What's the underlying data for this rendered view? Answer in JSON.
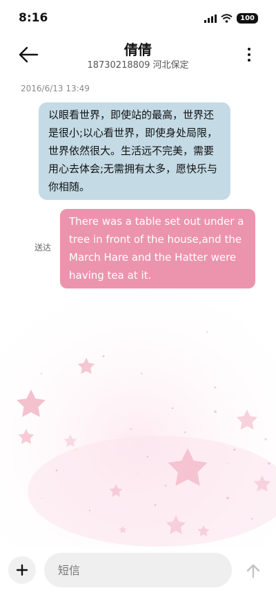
{
  "status_bar": {
    "time": "8:16",
    "battery": "100",
    "icons": [
      "signal-icon",
      "wifi-icon",
      "battery-icon"
    ]
  },
  "header": {
    "contact_name": "倩倩",
    "contact_detail": "18730218809 河北保定",
    "icons": [
      "back-arrow-icon",
      "more-vertical-icon"
    ]
  },
  "conversation": {
    "timestamp": "2016/6/13 13:49",
    "messages": [
      {
        "direction": "incoming",
        "text": "以眼看世界，即使站的最高，世界还是很小;以心看世界，即使身处局限，世界依然很大。生活远不完美，需要用心去体会;无需拥有太多，愿快乐与你相随。"
      },
      {
        "direction": "outgoing",
        "text": "There was a table set out under a tree in front of the house,and the March Hare and the Hatter were having tea at it.",
        "status": "送达"
      }
    ]
  },
  "composer": {
    "placeholder": "短信",
    "value": "",
    "icons": [
      "plus-icon",
      "send-arrow-icon"
    ]
  },
  "colors": {
    "incoming_bubble": "#c4dbe6",
    "outgoing_bubble": "#ec94ad",
    "wallpaper_star": "#f2b6c6"
  }
}
